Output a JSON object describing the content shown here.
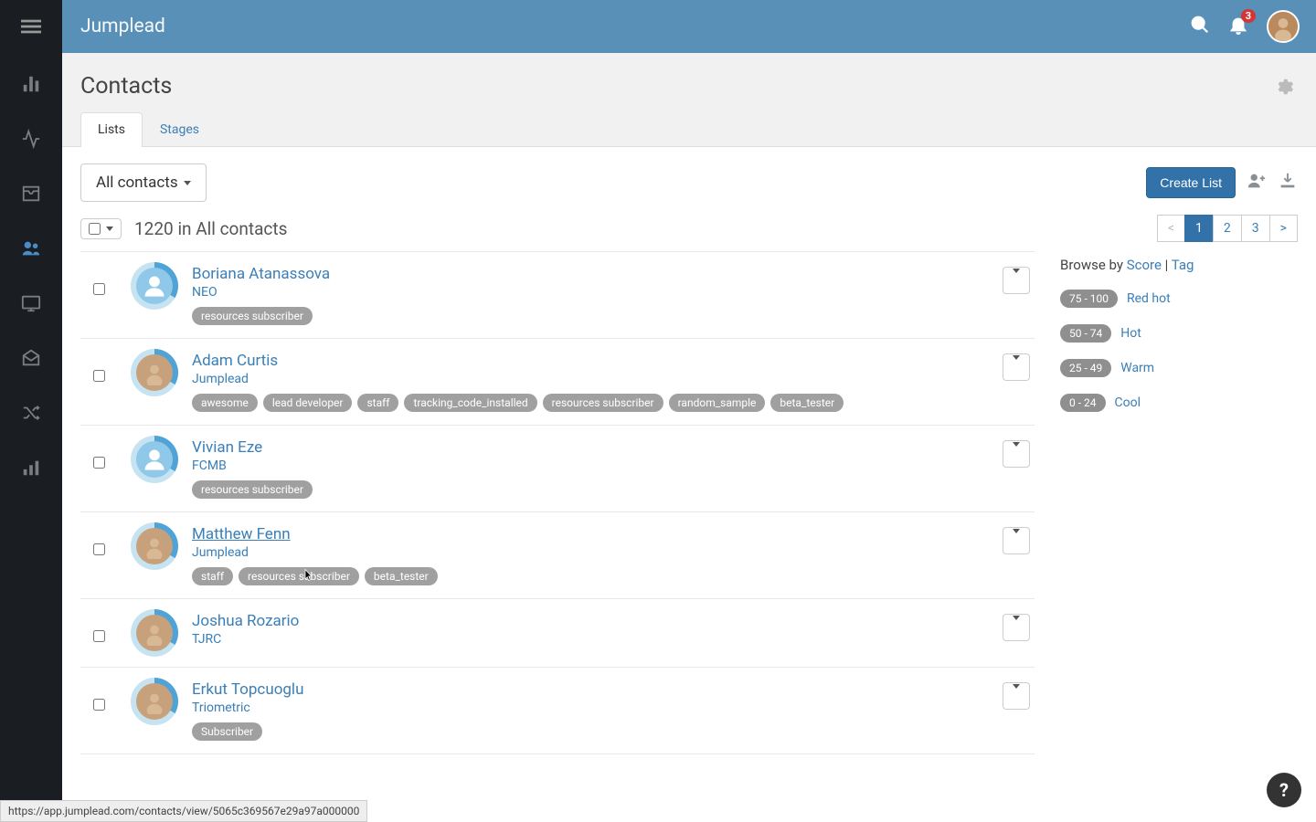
{
  "brand": "Jumplead",
  "notifications": 3,
  "header": {
    "title": "Contacts"
  },
  "tabs": {
    "active": "Lists",
    "items": [
      "Lists",
      "Stages"
    ]
  },
  "filter": {
    "label": "All contacts"
  },
  "toolbar": {
    "create_list": "Create List"
  },
  "list_summary": {
    "count": "1220",
    "context": "in All contacts"
  },
  "pagination": {
    "prev": "<",
    "pages": [
      "1",
      "2",
      "3"
    ],
    "next": ">",
    "active": "1"
  },
  "contacts": [
    {
      "name": "Boriana Atanassova",
      "company": "NEO",
      "tags": [
        "resources subscriber"
      ],
      "photo": false,
      "hovered": false
    },
    {
      "name": "Adam Curtis",
      "company": "Jumplead",
      "tags": [
        "awesome",
        "lead developer",
        "staff",
        "tracking_code_installed",
        "resources subscriber",
        "random_sample",
        "beta_tester"
      ],
      "photo": true,
      "hovered": false
    },
    {
      "name": "Vivian Eze",
      "company": "FCMB",
      "tags": [
        "resources subscriber"
      ],
      "photo": false,
      "hovered": false
    },
    {
      "name": "Matthew Fenn",
      "company": "Jumplead",
      "tags": [
        "staff",
        "resources subscriber",
        "beta_tester"
      ],
      "photo": true,
      "hovered": true
    },
    {
      "name": "Joshua Rozario",
      "company": "TJRC",
      "tags": [],
      "photo": true,
      "hovered": false
    },
    {
      "name": "Erkut Topcuoglu",
      "company": "Triometric",
      "tags": [
        "Subscriber"
      ],
      "photo": true,
      "hovered": false
    }
  ],
  "browse": {
    "label_prefix": "Browse by ",
    "score": "Score",
    "sep": " | ",
    "tag": "Tag",
    "scores": [
      {
        "range": "75 - 100",
        "label": "Red hot"
      },
      {
        "range": "50 - 74",
        "label": "Hot"
      },
      {
        "range": "25 - 49",
        "label": "Warm"
      },
      {
        "range": "0 - 24",
        "label": "Cool"
      }
    ]
  },
  "statusbar": "https://app.jumplead.com/contacts/view/5065c369567e29a97a000000"
}
